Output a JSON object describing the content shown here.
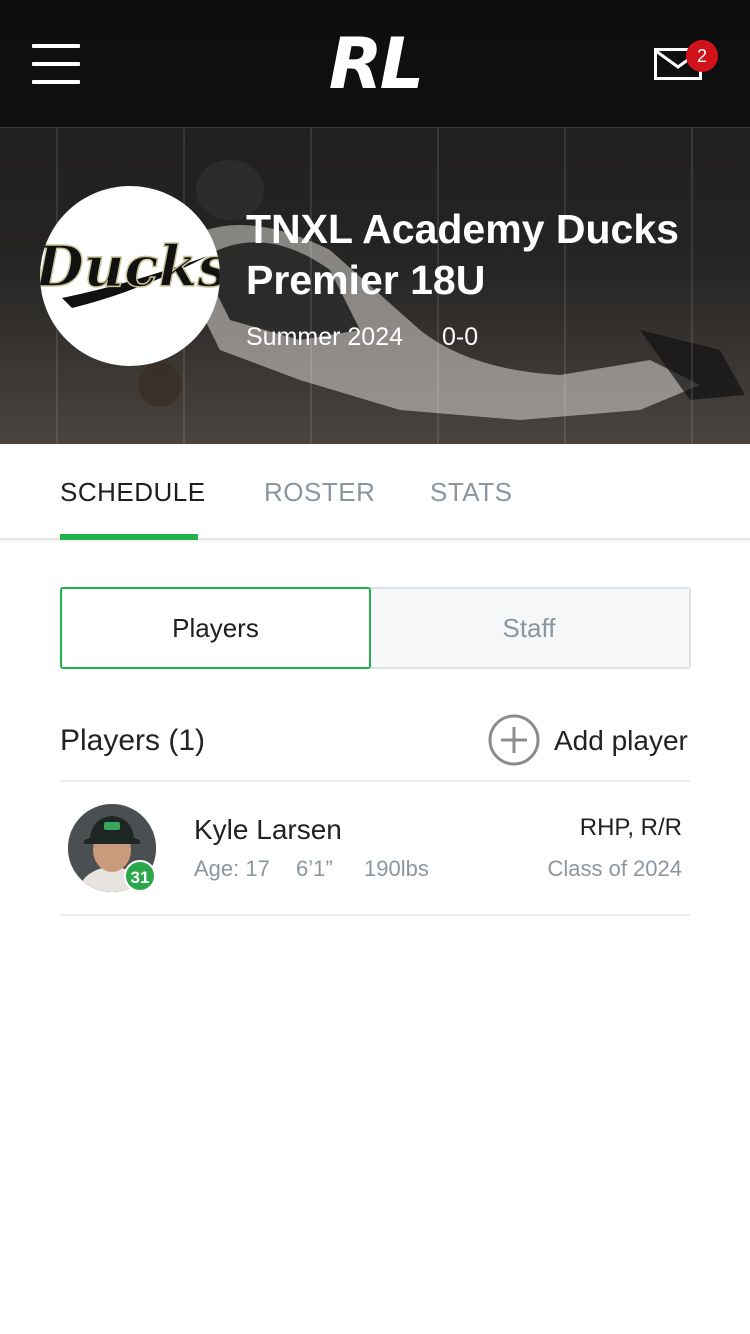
{
  "app": {
    "logo_text": "RL",
    "notification_count": "2"
  },
  "team": {
    "logo_text": "Ducks",
    "name": "TNXL Academy Ducks Premier 18U",
    "season": "Summer 2024",
    "record": "0-0"
  },
  "tabs": [
    {
      "label": "SCHEDULE",
      "active": true
    },
    {
      "label": "ROSTER",
      "active": false
    },
    {
      "label": "STATS",
      "active": false
    }
  ],
  "segment": {
    "players_label": "Players",
    "staff_label": "Staff",
    "selected": "Players"
  },
  "players_section": {
    "title": "Players (1)",
    "add_label": "Add player"
  },
  "players": [
    {
      "name": "Kyle Larsen",
      "jersey": "31",
      "age": "Age: 17",
      "height": "6’1”",
      "weight": "190lbs",
      "position": "RHP, R/R",
      "class": "Class of 2024"
    }
  ],
  "colors": {
    "accent": "#23b14d",
    "badge": "#d0121b",
    "muted_text": "#8c96a0"
  },
  "icons": {
    "menu": "hamburger-icon",
    "mail": "mail-icon",
    "add": "plus-circle-icon"
  }
}
